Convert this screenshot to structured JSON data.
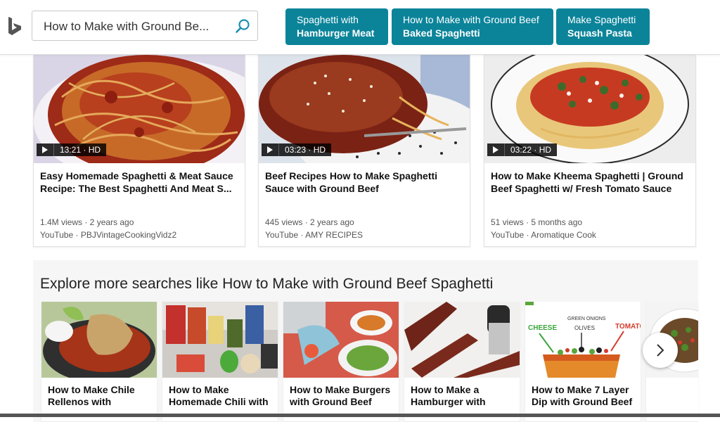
{
  "search": {
    "query": "How to Make with Ground Be..."
  },
  "chips": [
    {
      "line1": "Spaghetti with",
      "line2": "Hamburger Meat"
    },
    {
      "line1": "How to Make with Ground Beef",
      "line2": "Baked Spaghetti"
    },
    {
      "line1": "Make Spaghetti",
      "line2": "Squash Pasta"
    }
  ],
  "videos": [
    {
      "duration": "13:21 · HD",
      "title1": "Easy Homemade Spaghetti & Meat Sauce",
      "title2": "Recipe: The Best Spaghetti And Meat S...",
      "meta1": "1.4M views · 2 years ago",
      "meta2": "YouTube · PBJVintageCookingVidz2"
    },
    {
      "duration": "03:23 · HD",
      "title1": "Beef Recipes How to Make Spaghetti",
      "title2": "Sauce with Ground Beef",
      "meta1": "445 views · 2 years ago",
      "meta2": "YouTube · AMY RECIPES"
    },
    {
      "duration": "03:22 · HD",
      "title1": "How to Make Kheema Spaghetti | Ground",
      "title2": "Beef Spaghetti w/ Fresh Tomato Sauce",
      "meta1": "51 views · 5 months ago",
      "meta2": "YouTube · Aromatique Cook"
    }
  ],
  "explore": {
    "title": "Explore more searches like How to Make with Ground Beef Spaghetti",
    "items": [
      {
        "line1": "How to Make Chile",
        "line2": "Rellenos with"
      },
      {
        "line1": "How to Make",
        "line2": "Homemade Chili with"
      },
      {
        "line1": "How to Make Burgers",
        "line2": "with Ground Beef"
      },
      {
        "line1": "How to Make a",
        "line2": "Hamburger with"
      },
      {
        "line1": "How to Make 7 Layer",
        "line2": "Dip with Ground Beef"
      }
    ],
    "image_labels": {
      "cheese": "CHEESE",
      "green_onions": "GREEN ONIONS",
      "olives": "OLIVES",
      "tomatoes": "TOMATOES"
    }
  },
  "colors": {
    "chip": "#0b849a",
    "accent": "#1b8fb0"
  }
}
